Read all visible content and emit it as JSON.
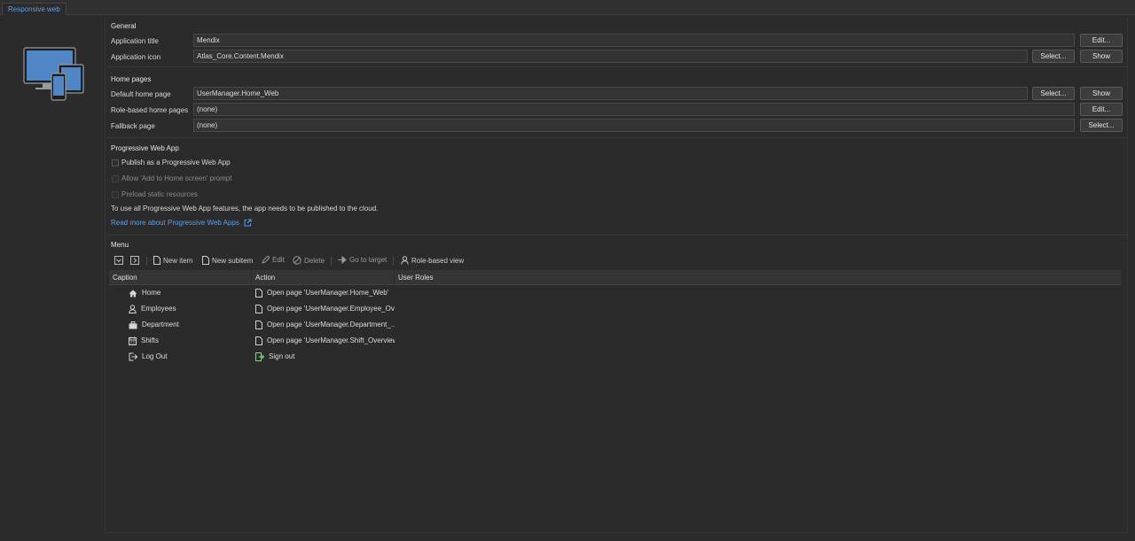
{
  "tab": {
    "label": "Responsive web"
  },
  "general": {
    "title": "General",
    "app_title": {
      "label": "Application title",
      "value": "Mendix",
      "edit": "Edit..."
    },
    "app_icon": {
      "label": "Application icon",
      "value": "Atlas_Core.Content.Mendix",
      "select": "Select...",
      "show": "Show"
    }
  },
  "home": {
    "title": "Home pages",
    "default": {
      "label": "Default home page",
      "value": "UserManager.Home_Web",
      "select": "Select...",
      "show": "Show"
    },
    "role": {
      "label": "Role-based home pages",
      "value": "(none)",
      "edit": "Edit..."
    },
    "fallback": {
      "label": "Fallback page",
      "value": "(none)",
      "select": "Select..."
    }
  },
  "pwa": {
    "title": "Progressive Web App",
    "publish": "Publish as a Progressive Web App",
    "allow": "Allow 'Add to Home screen' prompt",
    "preload": "Preload static resources",
    "note": "To use all Progressive Web App features, the app needs to be published to the cloud.",
    "link": "Read more about Progressive Web Apps"
  },
  "menu": {
    "title": "Menu",
    "toolbar": {
      "new_item": "New item",
      "new_subitem": "New subitem",
      "edit": "Edit",
      "delete": "Delete",
      "go_to_target": "Go to target",
      "role_view": "Role-based view"
    },
    "columns": [
      "Caption",
      "Action",
      "User Roles"
    ],
    "rows": [
      {
        "caption": "Home",
        "icon": "home-icon",
        "action": "Open page 'UserManager.Home_Web'",
        "action_icon": "page-icon"
      },
      {
        "caption": "Employees",
        "icon": "user-icon",
        "action": "Open page 'UserManager.Employee_Ov...",
        "action_icon": "page-icon"
      },
      {
        "caption": "Department",
        "icon": "briefcase-icon",
        "action": "Open page 'UserManager.Department_...",
        "action_icon": "page-icon"
      },
      {
        "caption": "Shifts",
        "icon": "calendar-icon",
        "action": "Open page 'UserManager.Shift_Overview'",
        "action_icon": "page-icon"
      },
      {
        "caption": "Log Out",
        "icon": "logout-icon",
        "action": "Sign out",
        "action_icon": "signout-icon"
      }
    ]
  },
  "colors": {
    "background": "#2b2b2b",
    "accent": "#5aa0e8",
    "button": "#3c3c3c"
  }
}
